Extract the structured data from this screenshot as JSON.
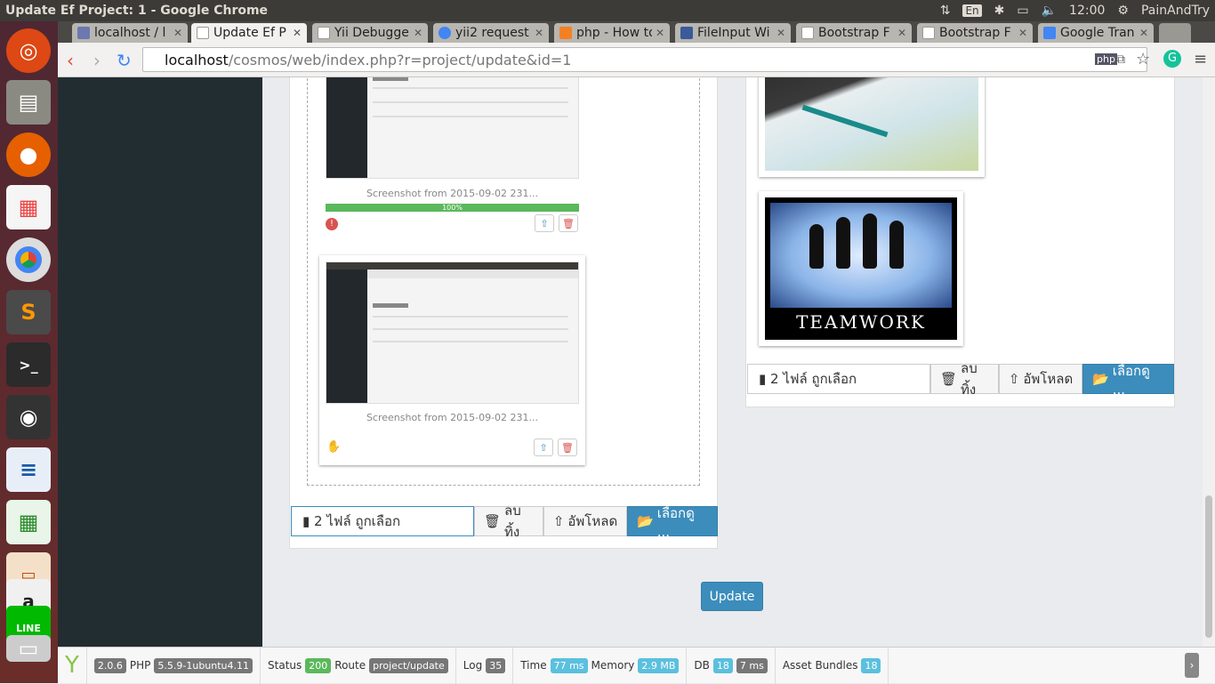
{
  "system": {
    "window_title": "Update Ef Project: 1 - Google Chrome",
    "keyboard": "En",
    "time": "12:00",
    "user": "PainAndTry"
  },
  "tabs": [
    {
      "label": "localhost / l",
      "favicon_color": "#6c78af"
    },
    {
      "label": "Update Ef P",
      "favicon_color": "#ffffff",
      "active": true
    },
    {
      "label": "Yii Debugge",
      "favicon_color": "#ffffff"
    },
    {
      "label": "yii2 request",
      "favicon_color": "#4285f4"
    },
    {
      "label": "php - How to",
      "favicon_color": "#f48024"
    },
    {
      "label": "FileInput Wi",
      "favicon_color": "#3a5a9a"
    },
    {
      "label": "Bootstrap F",
      "favicon_color": "#ffffff"
    },
    {
      "label": "Bootstrap F",
      "favicon_color": "#ffffff"
    },
    {
      "label": "Google Tran",
      "favicon_color": "#4285f4"
    }
  ],
  "address": {
    "host": "localhost",
    "path": "/cosmos/web/index.php?r=project/update&id=1"
  },
  "left_upload": {
    "file1_caption": "Screenshot from 2015-09-02 231...",
    "progress_label": "100%",
    "progress_value": 1.0,
    "file2_caption": "Screenshot from 2015-09-02 231...",
    "caption_text": "2 ไฟล์ ถูกเลือก",
    "remove_label": "ลบทิ้ง",
    "upload_label": "อัพโหลด",
    "browse_label": "เลือกดู ..."
  },
  "right_upload": {
    "teamwork_text": "TEAMWORK",
    "caption_text": "2 ไฟล์ ถูกเลือก",
    "remove_label": "ลบทิ้ง",
    "upload_label": "อัพโหลด",
    "browse_label": "เลือกดู ..."
  },
  "form": {
    "update_label": "Update"
  },
  "debug": {
    "yii_version": "2.0.6",
    "php_label": "PHP",
    "php_version": "5.5.9-1ubuntu4.11",
    "status_label": "Status",
    "status_code": "200",
    "route_label": "Route",
    "route": "project/update",
    "log_label": "Log",
    "log_count": "35",
    "time_label": "Time",
    "time": "77 ms",
    "memory_label": "Memory",
    "memory": "2.9 MB",
    "db_label": "DB",
    "db_count": "18",
    "db_time": "7 ms",
    "assets_label": "Asset Bundles",
    "assets_count": "18"
  }
}
